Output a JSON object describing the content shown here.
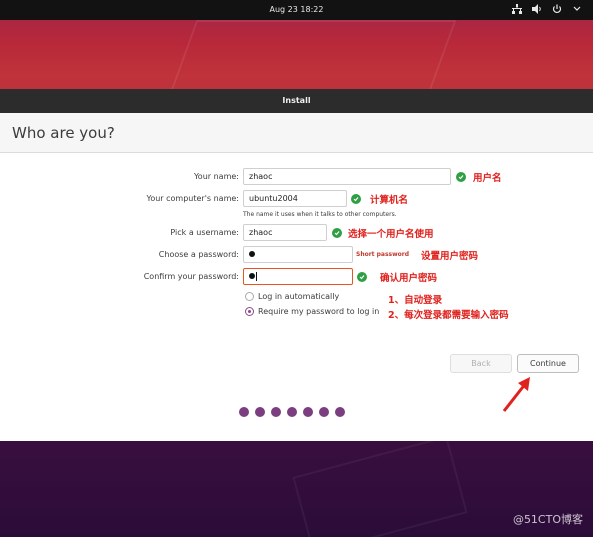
{
  "topbar": {
    "clock": "Aug 23  18:22"
  },
  "window": {
    "title": "Install",
    "page_title": "Who are you?"
  },
  "form": {
    "name": {
      "label": "Your name:",
      "value": "zhaoc"
    },
    "computer": {
      "label": "Your computer's name:",
      "value": "ubuntu2004",
      "hint": "The name it uses when it talks to other computers."
    },
    "username": {
      "label": "Pick a username:",
      "value": "zhaoc"
    },
    "password": {
      "label": "Choose a password:",
      "strength": "Short password"
    },
    "confirm": {
      "label": "Confirm your password:"
    },
    "login_auto": "Log in automatically",
    "login_require": "Require my password to log in"
  },
  "annotations": {
    "name": "用户名",
    "computer": "计算机名",
    "username": "选择一个用户名使用",
    "password": "设置用户密码",
    "confirm": "确认用户密码",
    "opt1": "1、自动登录",
    "opt2": "2、每次登录都需要输入密码"
  },
  "buttons": {
    "back": "Back",
    "continue": "Continue"
  },
  "progress": {
    "total": 7
  },
  "watermark": "@51CTO博客",
  "colors": {
    "accent": "#e95420",
    "check": "#2e9f43",
    "annotation": "#e0221e",
    "progress": "#7b3f7f"
  }
}
